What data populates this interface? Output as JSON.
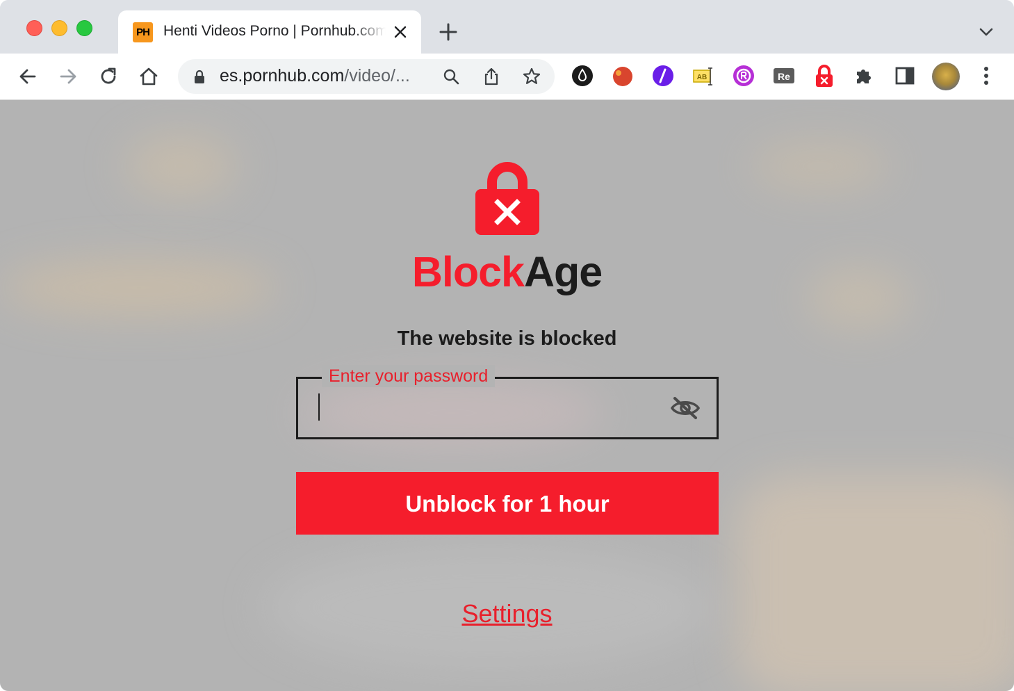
{
  "browser": {
    "tab": {
      "favicon_text": "PH",
      "title": "Henti Videos Porno | Pornhub.com"
    },
    "omnibox": {
      "host": "es.pornhub.com",
      "path": "/video/..."
    }
  },
  "page": {
    "brand_part1": "Block",
    "brand_part2": "Age",
    "message": "The website is blocked",
    "password_label": "Enter your password",
    "unblock_button": "Unblock for 1 hour",
    "settings_link": "Settings"
  },
  "colors": {
    "brand_red": "#f51d2c",
    "text_dark": "#1c1c1c",
    "page_bg": "#b3b3b3"
  }
}
